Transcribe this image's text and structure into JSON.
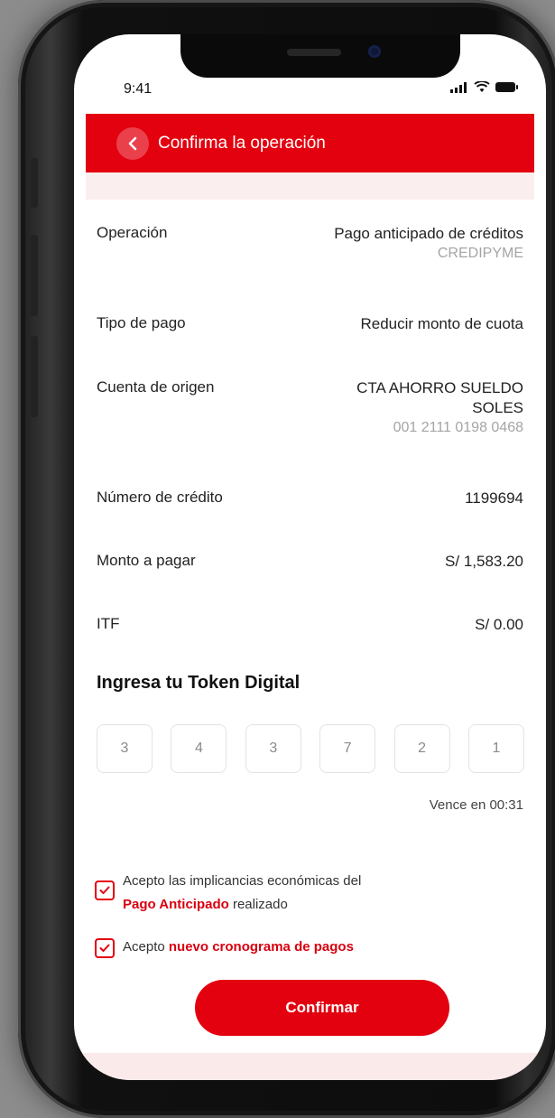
{
  "status": {
    "time": "9:41"
  },
  "header": {
    "title": "Confirma la operación"
  },
  "details": [
    {
      "label": "Operación",
      "value": "Pago anticipado de créditos",
      "sub": "CREDIPYME"
    },
    {
      "label": "Tipo de pago",
      "value": "Reducir monto de cuota"
    },
    {
      "label": "Cuenta de origen",
      "value": "CTA AHORRO SUELDO",
      "value2": "SOLES",
      "sub": "001 2111 0198 0468"
    },
    {
      "label": "Número de crédito",
      "value": "1199694"
    },
    {
      "label": "Monto a pagar",
      "value": "S/ 1,583.20"
    },
    {
      "label": "ITF",
      "value": "S/ 0.00"
    }
  ],
  "token": {
    "title": "Ingresa tu Token Digital",
    "digits": [
      "3",
      "4",
      "3",
      "7",
      "2",
      "1"
    ],
    "expires": "Vence en 00:31"
  },
  "checks": {
    "first": {
      "text": "Acepto las implicancias económicas del",
      "link": "Pago Anticipado",
      "suffix": "realizado",
      "checked": true
    },
    "second": {
      "text": "Acepto",
      "link": "nuevo cronograma de pagos",
      "checked": true
    }
  },
  "confirm_label": "Confirmar",
  "colors": {
    "accent": "#e3000f",
    "muted": "#a5a5a5"
  }
}
